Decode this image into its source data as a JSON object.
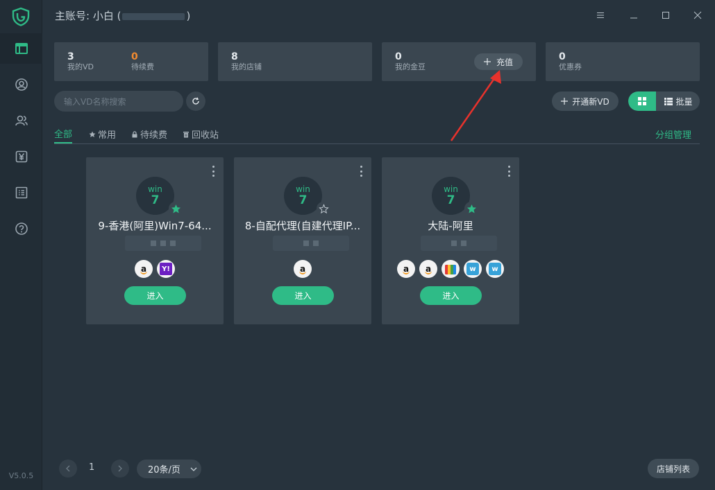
{
  "app": {
    "title_prefix": "主账号: 小白 (",
    "title_suffix": ")",
    "version": "V5.0.5"
  },
  "colors": {
    "accent": "#2fbb87",
    "orange": "#f28b30",
    "bg": "#27333d",
    "card": "#3a4650"
  },
  "sidebar": {
    "items": [
      {
        "name": "dashboard",
        "icon": "layout-icon",
        "active": true
      },
      {
        "name": "account",
        "icon": "user-circle-icon"
      },
      {
        "name": "members",
        "icon": "users-icon"
      },
      {
        "name": "billing",
        "icon": "yen-icon"
      },
      {
        "name": "orders",
        "icon": "list-icon"
      },
      {
        "name": "help",
        "icon": "question-icon"
      }
    ]
  },
  "stats": [
    {
      "items": [
        {
          "value": "3",
          "label": "我的VD"
        },
        {
          "value": "0",
          "label": "待续费"
        }
      ]
    },
    {
      "items": [
        {
          "value": "8",
          "label": "我的店铺"
        }
      ]
    },
    {
      "items": [
        {
          "value": "0",
          "label": "我的金豆"
        }
      ],
      "button": "充值"
    },
    {
      "items": [
        {
          "value": "0",
          "label": "优惠券"
        }
      ]
    }
  ],
  "toolbar": {
    "search_placeholder": "输入VD名称搜索",
    "open_vd_label": "开通新VD",
    "batch_label": "批量"
  },
  "tabs": [
    {
      "label": "全部",
      "active": true
    },
    {
      "label": "常用",
      "icon": "star-icon"
    },
    {
      "label": "待续费",
      "icon": "lock-icon"
    },
    {
      "label": "回收站",
      "icon": "trash-icon"
    }
  ],
  "group_manage_label": "分组管理",
  "vd_cards": [
    {
      "os": "win",
      "ver": "7",
      "name": "9-香港(阿里)Win7-64...",
      "starred": true,
      "platforms": [
        "amazon",
        "yahoo"
      ],
      "enter": "进入"
    },
    {
      "os": "win",
      "ver": "7",
      "name": "8-自配代理(自建代理IP...",
      "starred": false,
      "platforms": [
        "amazon"
      ],
      "enter": "进入"
    },
    {
      "os": "win",
      "ver": "7",
      "name": "大陆-阿里",
      "starred": true,
      "platforms": [
        "amazon",
        "amazon",
        "shop",
        "wish",
        "wish"
      ],
      "enter": "进入"
    }
  ],
  "pagination": {
    "page": "1",
    "page_size": "20条/页"
  },
  "store_list_label": "店铺列表"
}
